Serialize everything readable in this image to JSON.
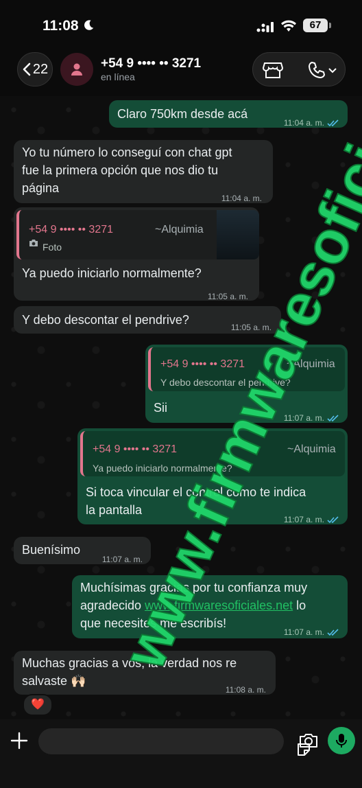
{
  "status_bar": {
    "time": "11:08",
    "battery": "67"
  },
  "header": {
    "back_count": "22",
    "contact_name": "+54 9 •••• •• 3271",
    "contact_status": "en línea"
  },
  "messages": [
    {
      "dir": "out",
      "text": "Claro 750km desde acá",
      "time": "11:04 a. m."
    },
    {
      "dir": "in",
      "lines": [
        "Yo tu número lo conseguí con chat gpt",
        "fue la primera opción que nos dio tu",
        "página"
      ],
      "time": "11:04 a. m."
    },
    {
      "dir": "in",
      "quote_name": "+54 9 •••• •• 3271",
      "quote_alias": "~Alquimia",
      "quote_text": "Foto",
      "text": "Ya puedo iniciarlo normalmente?",
      "time": "11:05 a. m."
    },
    {
      "dir": "in",
      "text": "Y debo descontar el pendrive?",
      "time": "11:05 a. m."
    },
    {
      "dir": "out",
      "quote_name": "+54 9 •••• •• 3271",
      "quote_alias": "~Alquimia",
      "quote_text": "Y debo descontar el pendrive?",
      "text": "Sii",
      "time": "11:07 a. m."
    },
    {
      "dir": "out",
      "quote_name": "+54 9 •••• •• 3271",
      "quote_alias": "~Alquimia",
      "quote_text": "Ya puedo iniciarlo normalmente?",
      "lines": [
        "Si toca vincular el control como te indica",
        "la pantalla"
      ],
      "time": "11:07 a. m."
    },
    {
      "dir": "in",
      "text": "Buenísimo",
      "time": "11:07 a. m."
    },
    {
      "dir": "out",
      "line1": "Muchísimas gracias por tu confianza muy",
      "line2_pre": "agradecido ",
      "link": "www.firmwaresoficiales.net",
      "line2_post": " lo",
      "line3": "que necesites me escribís!",
      "time": "11:07 a. m."
    },
    {
      "dir": "in",
      "lines": [
        "Muchas gracias a vos, la verdad nos re",
        "salvaste 🙌🏻"
      ],
      "time": "11:08 a. m.",
      "reaction": "❤️"
    }
  ],
  "watermark": "www.firmwaresoficiales.net",
  "colors": {
    "outgoing": "#144d37",
    "incoming": "#242626",
    "accent": "#1daa61",
    "quote_bar": "#e2768d",
    "read_ticks": "#53bdeb"
  },
  "icons": [
    "moon-icon",
    "signal-icon",
    "wifi-icon",
    "chevron-left-icon",
    "person-icon",
    "store-icon",
    "phone-icon",
    "chevron-down-icon",
    "double-check-icon",
    "camera-icon",
    "plus-icon",
    "sticker-icon",
    "mic-icon",
    "heart-reaction"
  ]
}
